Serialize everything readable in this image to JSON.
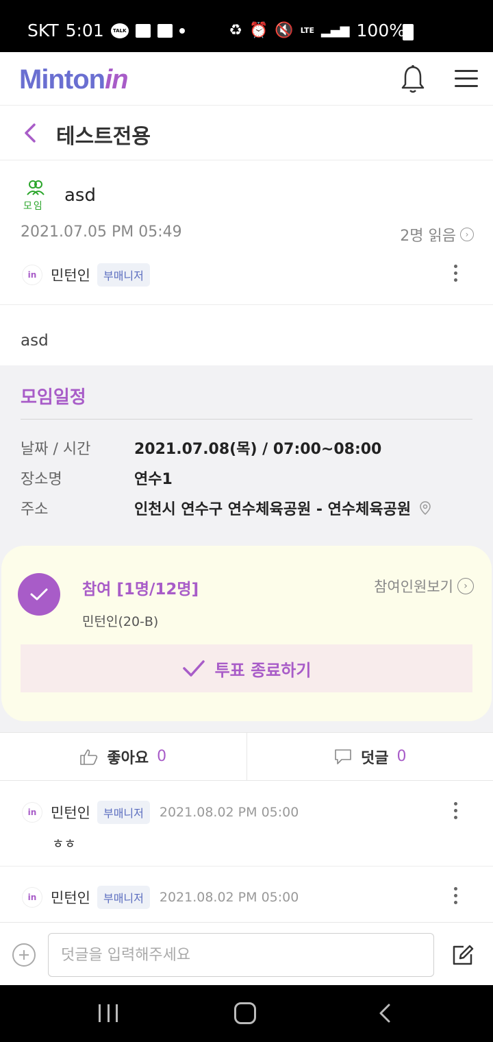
{
  "status_bar": {
    "carrier": "SKT",
    "time": "5:01",
    "talk_icon_text": "TALK",
    "network": "LTE",
    "battery": "100%"
  },
  "header": {
    "logo_text": "Minton",
    "logo_accent": "in"
  },
  "title_bar": {
    "title": "테스트전용"
  },
  "post": {
    "type_label": "모임",
    "title": "asd",
    "date": "2021.07.05 PM 05:49",
    "read_count": "2명 읽음",
    "author": "민턴인",
    "author_badge": "부매니저",
    "body": "asd"
  },
  "schedule": {
    "title": "모임일정",
    "rows": [
      {
        "key": "날짜 / 시간",
        "value": "2021.07.08(목) / 07:00~08:00"
      },
      {
        "key": "장소명",
        "value": "연수1"
      },
      {
        "key": "주소",
        "value": "인천시 연수구 연수체육공원 - 연수체육공원"
      }
    ]
  },
  "vote": {
    "title": "참여 [1명/12명]",
    "view_members": "참여인원보기",
    "members": "민턴인(20-B)",
    "end_button": "투표 종료하기"
  },
  "actions": {
    "like_label": "좋아요",
    "like_count": "0",
    "comment_label": "덧글",
    "comment_count": "0"
  },
  "comments": [
    {
      "author": "민턴인",
      "badge": "부매니저",
      "date": "2021.08.02 PM 05:00",
      "text": "ㅎㅎ"
    },
    {
      "author": "민턴인",
      "badge": "부매니저",
      "date": "2021.08.02 PM 05:00",
      "text": ""
    }
  ],
  "comment_input": {
    "placeholder": "덧글을 입력해주세요"
  },
  "colors": {
    "accent": "#a85cc8",
    "logo_blue": "#6a6fd1",
    "badge_bg": "#eef1f7",
    "vote_bg": "#fdfdea"
  }
}
